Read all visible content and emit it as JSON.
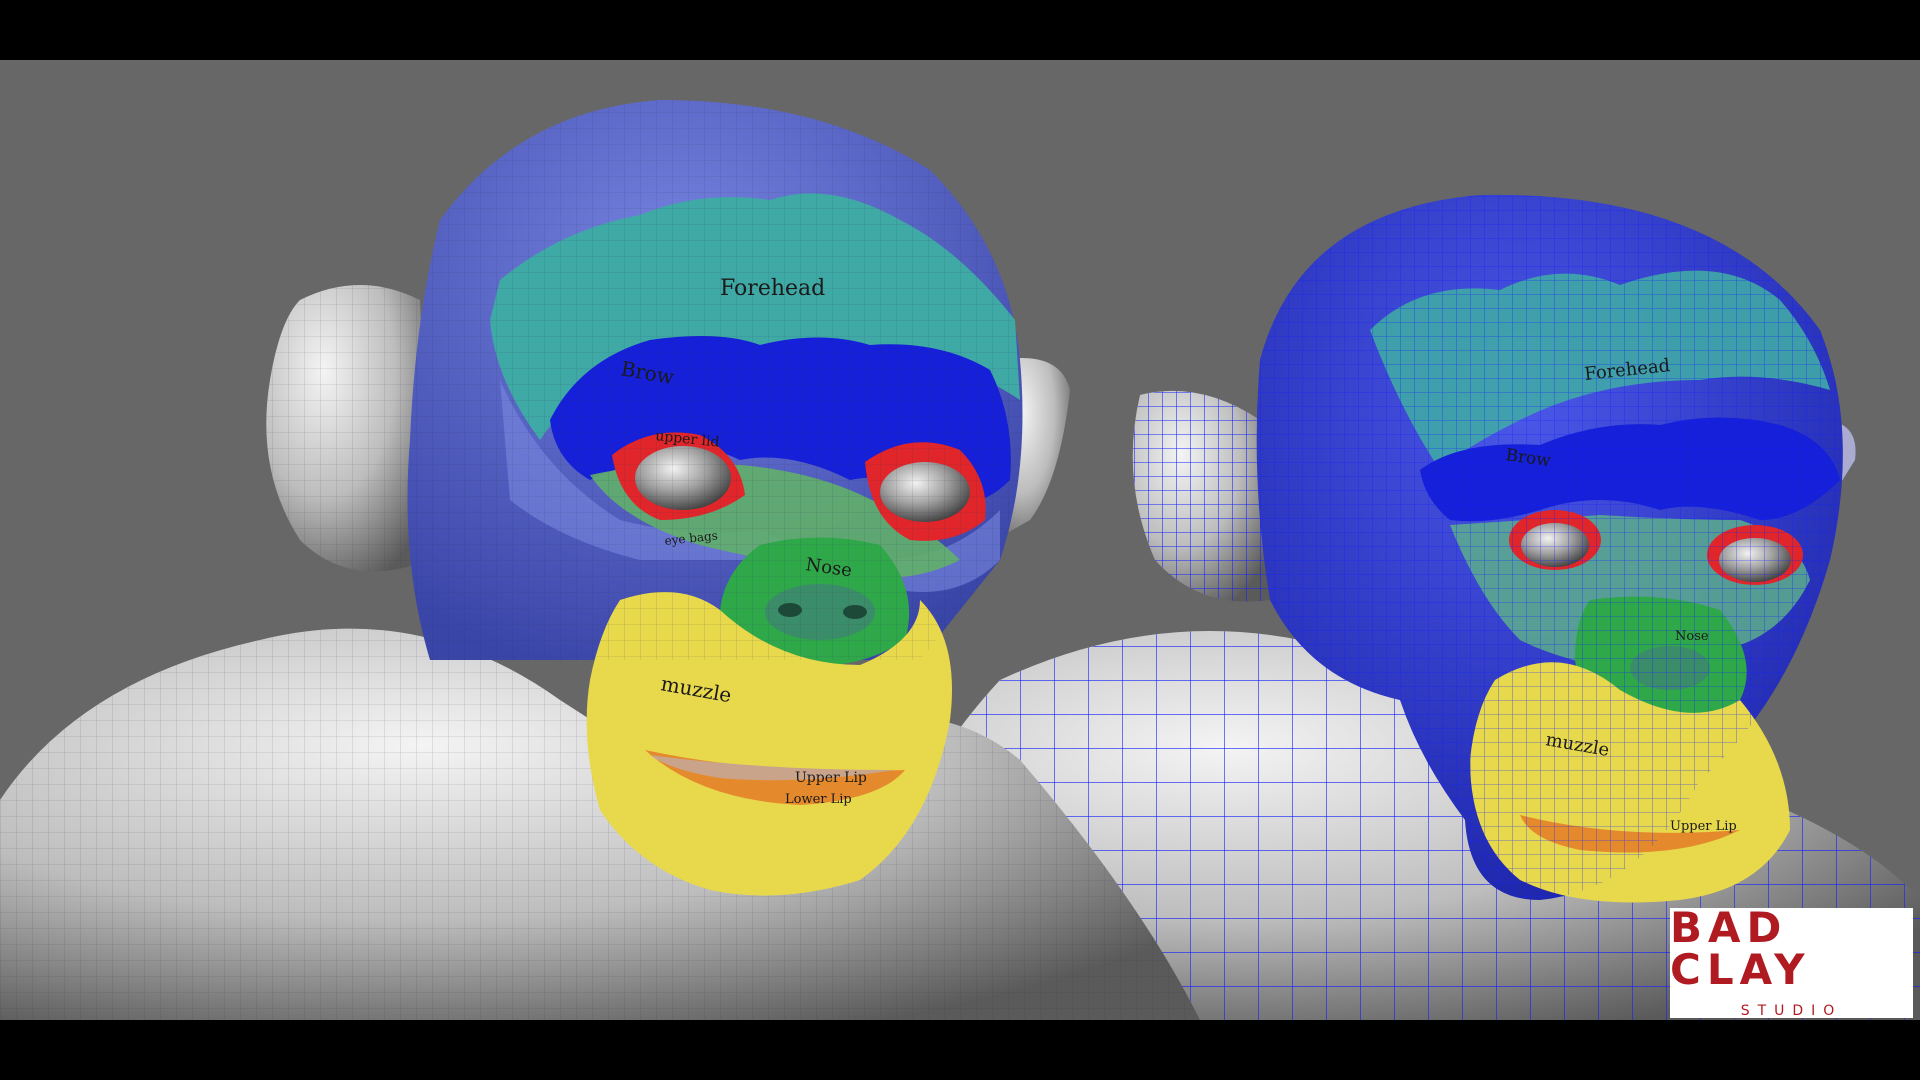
{
  "left_model": {
    "labels": {
      "forehead": "Forehead",
      "brow": "Brow",
      "upper_lid": "upper lid",
      "eye_bags": "eye bags",
      "nose": "Nose",
      "muzzle": "muzzle",
      "upper_lip": "Upper Lip",
      "lower_lip": "Lower Lip"
    }
  },
  "right_model": {
    "labels": {
      "forehead": "Forehead",
      "brow": "Brow",
      "nose": "Nose",
      "muzzle": "muzzle",
      "upper_lip": "Upper Lip"
    }
  },
  "logo": {
    "main": "BAD CLAY",
    "sub": "STUDIO"
  },
  "colors": {
    "background": "#666766",
    "letterbox": "#000000",
    "skull": "#5a66c8",
    "forehead": "#3fa9a6",
    "brow": "#1520d8",
    "eyelid": "#e0262a",
    "eye_bags": "#62b06a",
    "nose": "#2fa84a",
    "muzzle": "#e8d84c",
    "lips": "#e58a2c",
    "wire": "#1420ff",
    "logo_red": "#b01b22"
  }
}
